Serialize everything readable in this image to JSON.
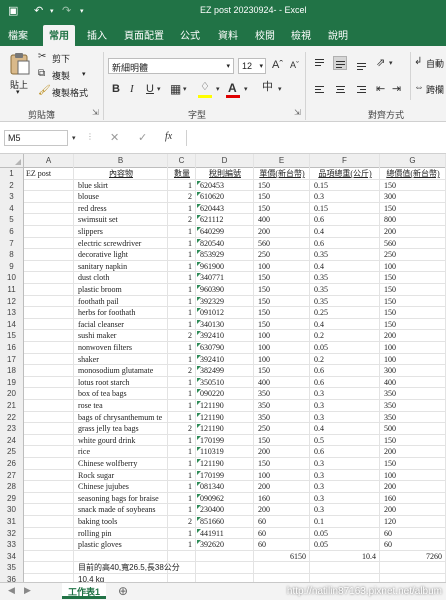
{
  "window": {
    "title": "EZ post 20230924-  -  Excel"
  },
  "tabs": [
    "檔案",
    "常用",
    "插入",
    "頁面配置",
    "公式",
    "資料",
    "校閱",
    "檢視",
    "說明"
  ],
  "ribbon": {
    "paste": "貼上",
    "cut": "剪下",
    "copy": "複製",
    "format_painter": "複製格式",
    "font_name": "新細明體",
    "font_size": "12",
    "group_clipboard": "剪貼簿",
    "group_font": "字型",
    "group_alignment": "對齊方式",
    "wrap_text": "自動",
    "merge_center": "跨欄"
  },
  "formula_bar": {
    "name_box": "M5",
    "fx": "fx",
    "content": ""
  },
  "columns": [
    "A",
    "B",
    "C",
    "D",
    "E",
    "F",
    "G"
  ],
  "header_row": {
    "A": "EZ post",
    "B": "內容物",
    "C": "數量",
    "D": "稅則編號",
    "E": "單價(新台幣)",
    "F": "品項總重(公斤)",
    "G": "總價值(新台幣)"
  },
  "items": [
    {
      "b": "blue skirt",
      "c": "1",
      "d": "620453",
      "e": "150",
      "f": "0.15",
      "g": "150"
    },
    {
      "b": "blouse",
      "c": "2",
      "d": "610620",
      "e": "150",
      "f": "0.3",
      "g": "300"
    },
    {
      "b": "red dress",
      "c": "1",
      "d": "620443",
      "e": "150",
      "f": "0.15",
      "g": "150"
    },
    {
      "b": "swimsuit set",
      "c": "2",
      "d": "621112",
      "e": "400",
      "f": "0.6",
      "g": "800"
    },
    {
      "b": "slippers",
      "c": "1",
      "d": "640299",
      "e": "200",
      "f": "0.4",
      "g": "200"
    },
    {
      "b": "electric screwdriver",
      "c": "1",
      "d": "820540",
      "e": "560",
      "f": "0.6",
      "g": "560"
    },
    {
      "b": "decorative light",
      "c": "1",
      "d": "853929",
      "e": "250",
      "f": "0.35",
      "g": "250"
    },
    {
      "b": "sanitary napkin",
      "c": "1",
      "d": "961900",
      "e": "100",
      "f": "0.4",
      "g": "100"
    },
    {
      "b": "dust cloth",
      "c": "1",
      "d": "340771",
      "e": "150",
      "f": "0.35",
      "g": "150"
    },
    {
      "b": "plastic broom",
      "c": "1",
      "d": "960390",
      "e": "150",
      "f": "0.35",
      "g": "150"
    },
    {
      "b": "foothath pail",
      "c": "1",
      "d": "392329",
      "e": "150",
      "f": "0.35",
      "g": "150"
    },
    {
      "b": "herbs for foothath",
      "c": "1",
      "d": "091012",
      "e": "150",
      "f": "0.25",
      "g": "150"
    },
    {
      "b": "facial cleanser",
      "c": "1",
      "d": "340130",
      "e": "150",
      "f": "0.4",
      "g": "150"
    },
    {
      "b": "sushi maker",
      "c": "2",
      "d": "392410",
      "e": "100",
      "f": "0.2",
      "g": "200"
    },
    {
      "b": "nonwoven filters",
      "c": "1",
      "d": "630790",
      "e": "100",
      "f": "0.05",
      "g": "100"
    },
    {
      "b": "shaker",
      "c": "1",
      "d": "392410",
      "e": "100",
      "f": "0.2",
      "g": "100"
    },
    {
      "b": "monosodium glutamate",
      "c": "2",
      "d": "382499",
      "e": "150",
      "f": "0.6",
      "g": "300"
    },
    {
      "b": "lotus root starch",
      "c": "1",
      "d": "350510",
      "e": "400",
      "f": "0.6",
      "g": "400"
    },
    {
      "b": "box of tea bags",
      "c": "1",
      "d": "090220",
      "e": "350",
      "f": "0.3",
      "g": "350"
    },
    {
      "b": "rose tea",
      "c": "1",
      "d": "121190",
      "e": "350",
      "f": "0.3",
      "g": "350"
    },
    {
      "b": "bags of chrysanthemum te",
      "c": "1",
      "d": "121190",
      "e": "350",
      "f": "0.3",
      "g": "350"
    },
    {
      "b": "grass jelly tea bags",
      "c": "2",
      "d": "121190",
      "e": "250",
      "f": "0.4",
      "g": "500"
    },
    {
      "b": "white gourd drink",
      "c": "1",
      "d": "170199",
      "e": "150",
      "f": "0.5",
      "g": "150"
    },
    {
      "b": "rice",
      "c": "1",
      "d": "110319",
      "e": "200",
      "f": "0.6",
      "g": "200"
    },
    {
      "b": "Chinese wolfberry",
      "c": "1",
      "d": "121190",
      "e": "150",
      "f": "0.3",
      "g": "150"
    },
    {
      "b": "Rock sugar",
      "c": "1",
      "d": "170199",
      "e": "100",
      "f": "0.3",
      "g": "100"
    },
    {
      "b": "Chinese jujubes",
      "c": "1",
      "d": "081340",
      "e": "200",
      "f": "0.3",
      "g": "200"
    },
    {
      "b": "seasoning bags for braise",
      "c": "1",
      "d": "090962",
      "e": "160",
      "f": "0.3",
      "g": "160"
    },
    {
      "b": "snack made of soybeans",
      "c": "1",
      "d": "230400",
      "e": "200",
      "f": "0.3",
      "g": "200"
    },
    {
      "b": "baking tools",
      "c": "2",
      "d": "851660",
      "e": "60",
      "f": "0.1",
      "g": "120"
    },
    {
      "b": "rolling pin",
      "c": "1",
      "d": "441911",
      "e": "60",
      "f": "0.05",
      "g": "60"
    },
    {
      "b": "plastic gloves",
      "c": "1",
      "d": "392620",
      "e": "60",
      "f": "0.05",
      "g": "60"
    }
  ],
  "totals": {
    "e": "6150",
    "f": "10.4",
    "g": "7260"
  },
  "notes": [
    "目前的高40,寬26.5,長38公分",
    "10.4 kg"
  ],
  "sheet_tab": "工作表1",
  "watermark": "http://natilin87163.pixnet.net/album",
  "colors": {
    "accent": "#217346",
    "grid": "#e3e3e3"
  }
}
